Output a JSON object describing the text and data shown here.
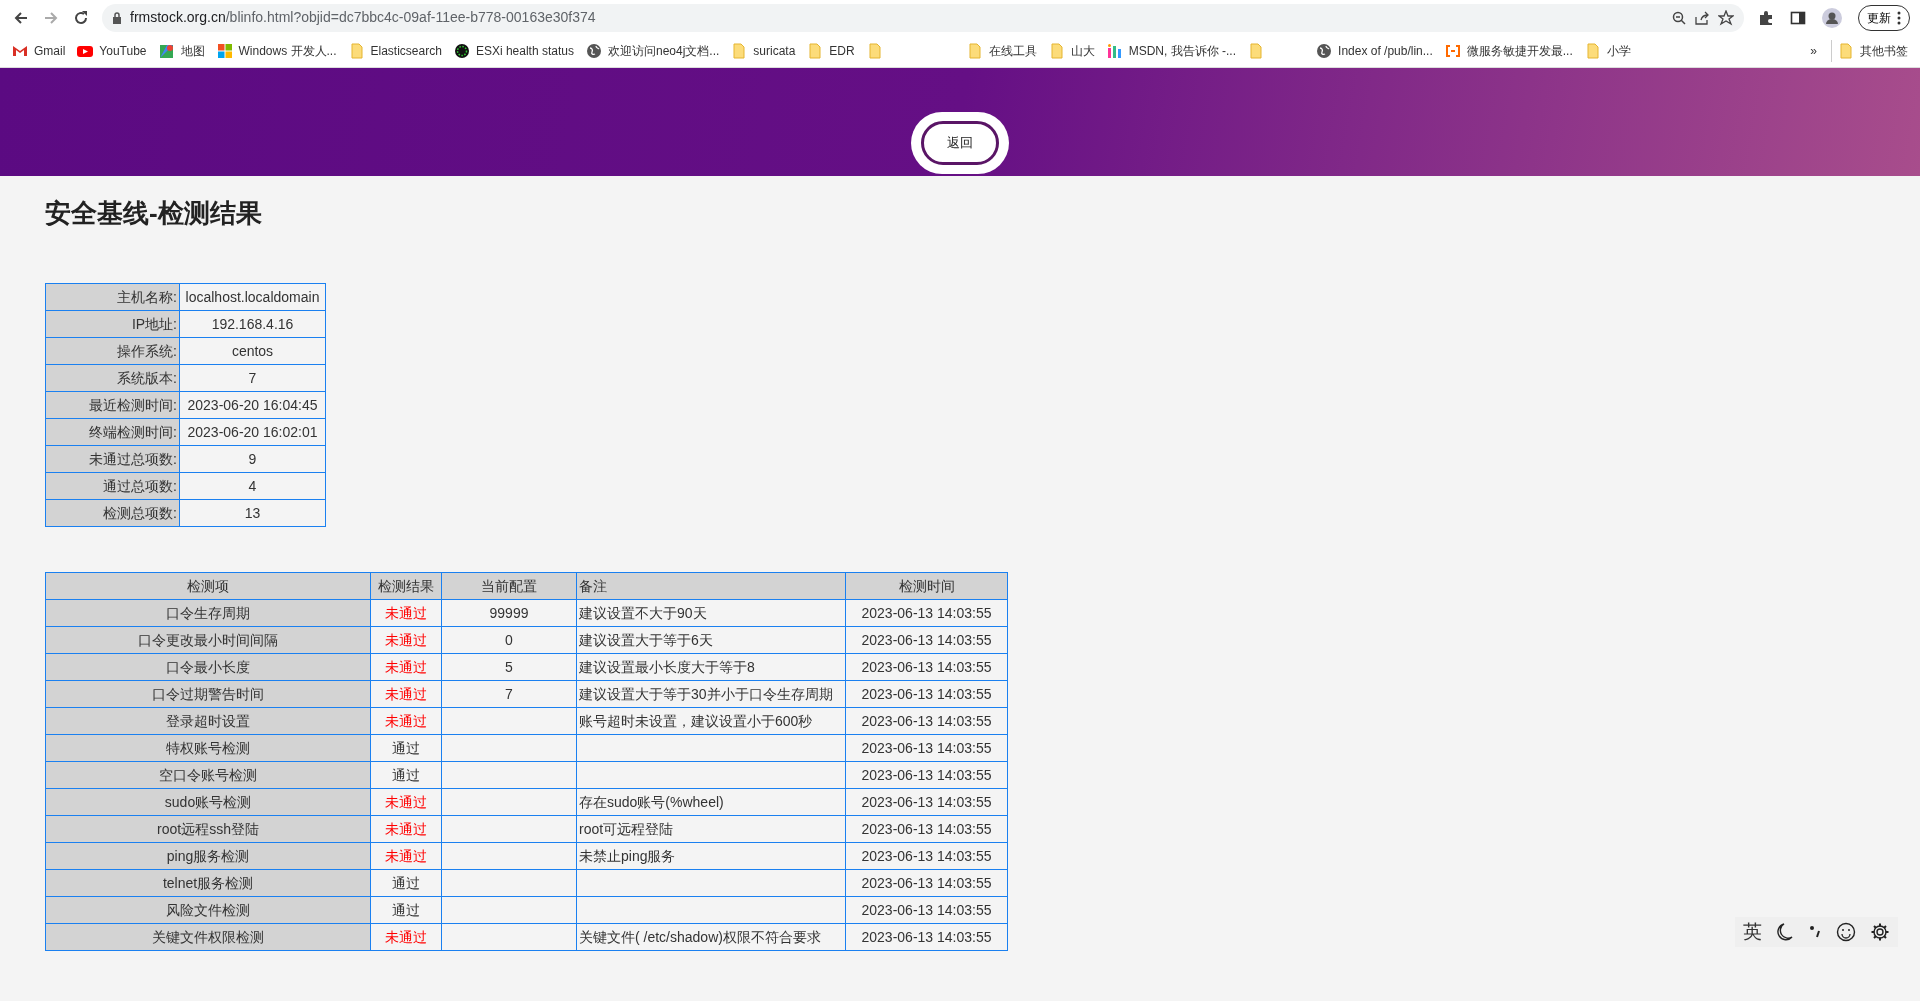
{
  "browser": {
    "url_host": "frmstock.org.cn",
    "url_path": "/blinfo.html?objid=dc7bbc4c-09af-11ee-b778-00163e30f374",
    "update_button": "更新"
  },
  "bookmarks": [
    {
      "kind": "site",
      "label": "Gmail"
    },
    {
      "kind": "site",
      "label": "YouTube"
    },
    {
      "kind": "site",
      "label": "地图"
    },
    {
      "kind": "site",
      "label": "Windows 开发人..."
    },
    {
      "kind": "folder",
      "label": "Elasticsearch"
    },
    {
      "kind": "site",
      "label": "ESXi health status"
    },
    {
      "kind": "site",
      "label": "欢迎访问neo4j文档..."
    },
    {
      "kind": "folder",
      "label": "suricata"
    },
    {
      "kind": "folder",
      "label": "EDR"
    },
    {
      "kind": "folder"
    },
    {
      "kind": "folder",
      "label": "在线工具"
    },
    {
      "kind": "folder",
      "label": "山大"
    },
    {
      "kind": "site",
      "label": "MSDN, 我告诉你 -..."
    },
    {
      "kind": "folder"
    },
    {
      "kind": "site",
      "label": "Index of /pub/lin..."
    },
    {
      "kind": "site",
      "label": "微服务敏捷开发最..."
    },
    {
      "kind": "folder",
      "label": "小学"
    }
  ],
  "bookmarks_overflow": "»",
  "other_bookmarks": "其他书签",
  "back_button": "返回",
  "title": "安全基线-检测结果",
  "host_info": [
    {
      "label": "主机名称:",
      "value": "localhost.localdomain"
    },
    {
      "label": "IP地址:",
      "value": "192.168.4.16"
    },
    {
      "label": "操作系统:",
      "value": "centos"
    },
    {
      "label": "系统版本:",
      "value": "7"
    },
    {
      "label": "最近检测时间:",
      "value": "2023-06-20 16:04:45"
    },
    {
      "label": "终端检测时间:",
      "value": "2023-06-20 16:02:01"
    },
    {
      "label": "未通过总项数:",
      "value": "9"
    },
    {
      "label": "通过总项数:",
      "value": "4"
    },
    {
      "label": "检测总项数:",
      "value": "13"
    }
  ],
  "results": {
    "columns": [
      "检测项",
      "检测结果",
      "当前配置",
      "备注",
      "检测时间"
    ],
    "rows": [
      {
        "item": "口令生存周期",
        "result": "未通过",
        "passed": false,
        "config": "99999",
        "note": "建议设置不大于90天",
        "time": "2023-06-13 14:03:55"
      },
      {
        "item": "口令更改最小时间间隔",
        "result": "未通过",
        "passed": false,
        "config": "0",
        "note": "建议设置大于等于6天",
        "time": "2023-06-13 14:03:55"
      },
      {
        "item": "口令最小长度",
        "result": "未通过",
        "passed": false,
        "config": "5",
        "note": "建议设置最小长度大于等于8",
        "time": "2023-06-13 14:03:55"
      },
      {
        "item": "口令过期警告时间",
        "result": "未通过",
        "passed": false,
        "config": "7",
        "note": "建议设置大于等于30并小于口令生存周期",
        "time": "2023-06-13 14:03:55"
      },
      {
        "item": "登录超时设置",
        "result": "未通过",
        "passed": false,
        "note": "账号超时未设置，建议设置小于600秒",
        "time": "2023-06-13 14:03:55"
      },
      {
        "item": "特权账号检测",
        "result": "通过",
        "passed": true,
        "time": "2023-06-13 14:03:55"
      },
      {
        "item": "空口令账号检测",
        "result": "通过",
        "passed": true,
        "time": "2023-06-13 14:03:55"
      },
      {
        "item": "sudo账号检测",
        "result": "未通过",
        "passed": false,
        "note": "存在sudo账号(%wheel)",
        "time": "2023-06-13 14:03:55"
      },
      {
        "item": "root远程ssh登陆",
        "result": "未通过",
        "passed": false,
        "note": "root可远程登陆",
        "time": "2023-06-13 14:03:55"
      },
      {
        "item": "ping服务检测",
        "result": "未通过",
        "passed": false,
        "note": "未禁止ping服务",
        "time": "2023-06-13 14:03:55"
      },
      {
        "item": "telnet服务检测",
        "result": "通过",
        "passed": true,
        "time": "2023-06-13 14:03:55"
      },
      {
        "item": "风险文件检测",
        "result": "通过",
        "passed": true,
        "time": "2023-06-13 14:03:55"
      },
      {
        "item": "关键文件权限检测",
        "result": "未通过",
        "passed": false,
        "note": "关键文件( /etc/shadow)权限不符合要求",
        "time": "2023-06-13 14:03:55"
      }
    ]
  },
  "ime_bar": {
    "mode": "英"
  }
}
